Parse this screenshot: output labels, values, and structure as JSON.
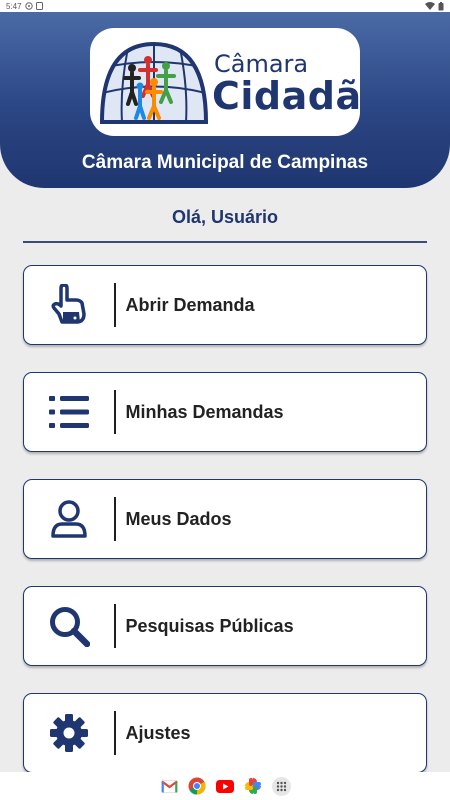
{
  "status_bar": {
    "time": "5:47"
  },
  "header": {
    "logo_top": "Câmara",
    "logo_bottom": "Cidadã",
    "title": "Câmara Municipal de Campinas"
  },
  "greeting": "Olá, Usuário",
  "menu": {
    "items": [
      {
        "label": "Abrir Demanda",
        "icon": "pointing-hand-icon"
      },
      {
        "label": "Minhas Demandas",
        "icon": "list-icon"
      },
      {
        "label": "Meus Dados",
        "icon": "user-icon"
      },
      {
        "label": "Pesquisas Públicas",
        "icon": "search-icon"
      },
      {
        "label": "Ajustes",
        "icon": "gear-icon"
      }
    ]
  },
  "nav_bar": {
    "apps": [
      "gmail-icon",
      "chrome-icon",
      "youtube-icon",
      "photos-icon",
      "app-drawer-icon"
    ]
  },
  "colors": {
    "primary": "#1f3670",
    "background": "#ececec"
  }
}
